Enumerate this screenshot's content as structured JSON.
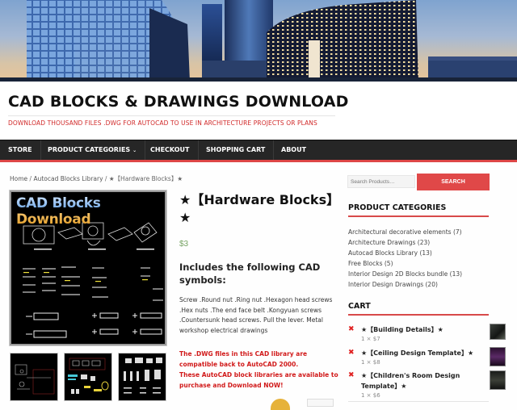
{
  "site": {
    "title": "CAD BLOCKS & DRAWINGS DOWNLOAD",
    "tagline": "DOWNLOAD THOUSAND FILES .DWG FOR AUTOCAD TO USE IN ARCHITECTURE PROJECTS OR PLANS"
  },
  "nav": {
    "items": [
      {
        "label": "STORE"
      },
      {
        "label": "PRODUCT CATEGORIES",
        "icon": "chevron-down-icon",
        "icon_glyph": "⌄"
      },
      {
        "label": "CHECKOUT"
      },
      {
        "label": "SHOPPING CART"
      },
      {
        "label": "ABOUT"
      }
    ],
    "accent_color": "#dd4646",
    "bg_color": "#262626"
  },
  "breadcrumb": {
    "home": "Home",
    "sep": " / ",
    "category": "Autocad Blocks Library",
    "current": "★【Hardware Blocks】★"
  },
  "product": {
    "image_caption": "CAD Blocks Download",
    "title": "★【Hardware Blocks】★",
    "price": "$3",
    "includes_heading": "Includes the following CAD symbols:",
    "description": "Screw .Round nut .Ring nut .Hexagon head screws .Hex nuts .The end face belt .Kongyuan screws .Countersunk head screws. Pull the lever. Metal workshop electrical drawings",
    "note_line1": "The .DWG files in this CAD library are compatible back to AutoCAD 2000.",
    "note_line2": "These AutoCAD block libraries are available to purchase and Download NOW!",
    "price_color": "#77a464",
    "note_color": "#d11a1a"
  },
  "sidebar": {
    "search": {
      "placeholder": "Search Products…",
      "button_label": "SEARCH"
    },
    "categories": {
      "heading": "PRODUCT CATEGORIES",
      "items": [
        {
          "label": "Architectural decorative elements (7)"
        },
        {
          "label": "Architecture Drawings (23)"
        },
        {
          "label": "Autocad Blocks Library (13)"
        },
        {
          "label": "Free Blocks (5)"
        },
        {
          "label": "Interior Design 2D Blocks bundle (13)"
        },
        {
          "label": "Interior Design Drawings (20)"
        }
      ]
    },
    "cart": {
      "heading": "CART",
      "remove_glyph": "✖",
      "items": [
        {
          "name": "★【Building Details】★",
          "qty": "1 × $7"
        },
        {
          "name": "★【Ceiling Design Template】★",
          "qty": "1 × $8"
        },
        {
          "name": "★【Children's Room Design Template】★",
          "qty": "1 × $6"
        }
      ]
    }
  }
}
